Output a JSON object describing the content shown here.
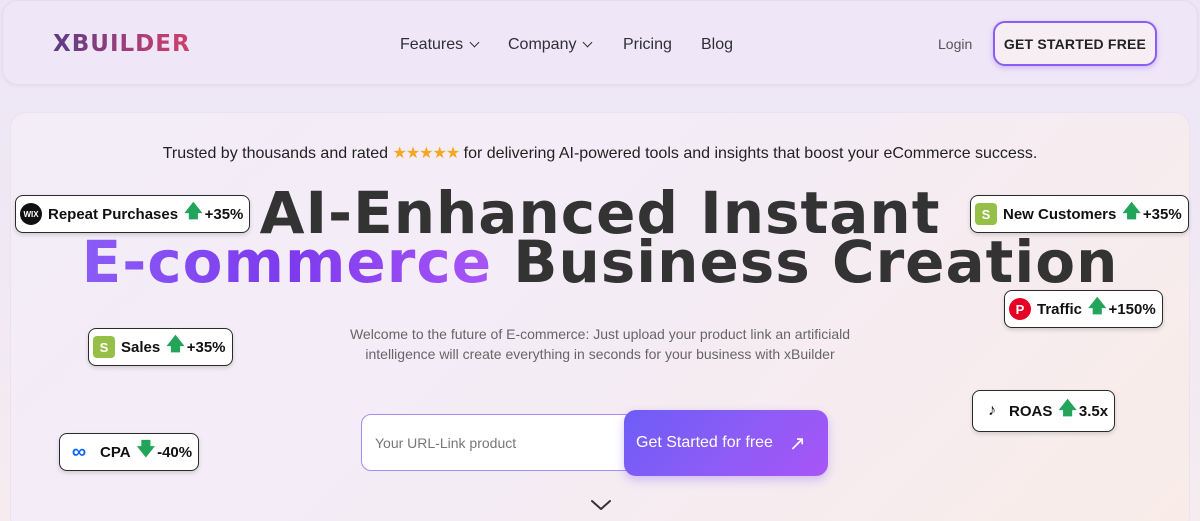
{
  "header": {
    "logo": "XBUILDER",
    "nav": [
      {
        "label": "Features"
      },
      {
        "label": "Company"
      },
      {
        "label": "Pricing"
      },
      {
        "label": "Blog"
      }
    ],
    "login_label": "Login",
    "cta_label": "GET STARTED FREE"
  },
  "hero": {
    "trusted_before": "Trusted by thousands and rated",
    "stars": "★★★★★",
    "trusted_after": "for delivering AI-powered tools and insights that boost your eCommerce success.",
    "headline_line1": "AI-Enhanced Instant",
    "headline_highlight": "E-commerce",
    "headline_rest": "Business Creation",
    "subtitle": "Welcome to the future of E-commerce: Just upload your product link an artificiald intelligence will create everything in seconds for your business with xBuilder",
    "input_placeholder": "Your URL-Link product",
    "input_value": "",
    "submit_label": "Get Started for free",
    "submit_arrow": "↗"
  },
  "badges": {
    "repeat": {
      "platform": "wix",
      "label": "Repeat Purchases",
      "change": "+35%",
      "direction": "up"
    },
    "sales": {
      "platform": "shopify",
      "label": "Sales",
      "change": "+35%",
      "direction": "up"
    },
    "cpa": {
      "platform": "meta",
      "label": "CPA",
      "change": "-40%",
      "direction": "down"
    },
    "new_customers": {
      "platform": "shopify",
      "label": "New Customers",
      "change": "+35%",
      "direction": "up"
    },
    "traffic": {
      "platform": "pinterest",
      "label": "Traffic",
      "change": "+150%",
      "direction": "up"
    },
    "roas": {
      "platform": "tiktok",
      "label": "ROAS",
      "change": "3.5x",
      "direction": "up"
    }
  },
  "colors": {
    "accent": "#8b5cf6",
    "up_arrow": "#22a55a",
    "stars": "#f5a623"
  }
}
